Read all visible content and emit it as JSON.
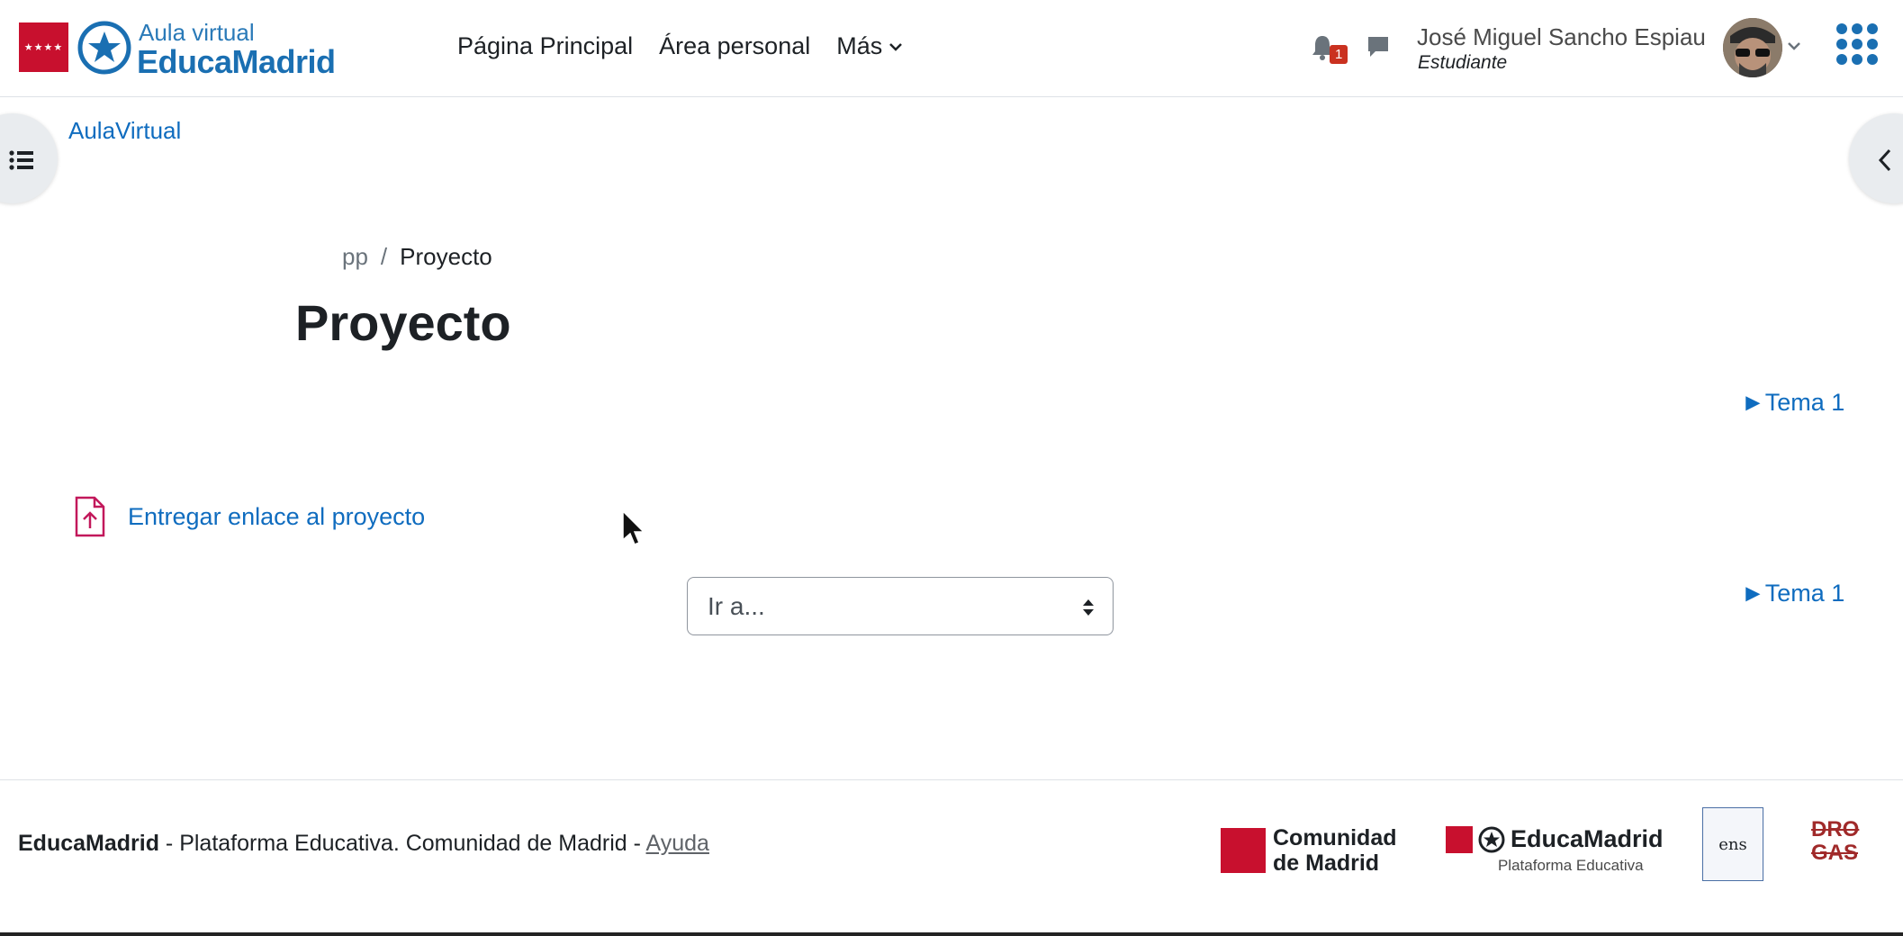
{
  "brand": {
    "line1": "Aula virtual",
    "line2": "EducaMadrid"
  },
  "nav": {
    "items": [
      {
        "label": "Página Principal"
      },
      {
        "label": "Área personal"
      },
      {
        "label": "Más"
      }
    ]
  },
  "notifications": {
    "count": "1"
  },
  "user": {
    "name": "José Miguel Sancho Espiau",
    "role": "Estudiante"
  },
  "site": {
    "link": "AulaVirtual"
  },
  "breadcrumb": {
    "parent": "pp",
    "separator": "/",
    "current": "Proyecto"
  },
  "page": {
    "title": "Proyecto"
  },
  "sections": {
    "top_link": "►Tema 1",
    "bottom_link": "►Tema 1"
  },
  "activity": {
    "label": "Entregar enlace al proyecto"
  },
  "jump": {
    "placeholder": "Ir a..."
  },
  "footer": {
    "brand": "EducaMadrid",
    "text": " - Plataforma Educativa. Comunidad de Madrid - ",
    "help": "Ayuda",
    "logos": {
      "cm": "Comunidad de Madrid",
      "em_name": "EducaMadrid",
      "em_sub": "Plataforma Educativa",
      "ens": "ens",
      "drogas": "DRO GAS"
    }
  },
  "colors": {
    "link": "#0f6cbf",
    "brand_blue": "#1a6fb2",
    "madrid_red": "#c8102e",
    "badge": "#ca3120"
  }
}
